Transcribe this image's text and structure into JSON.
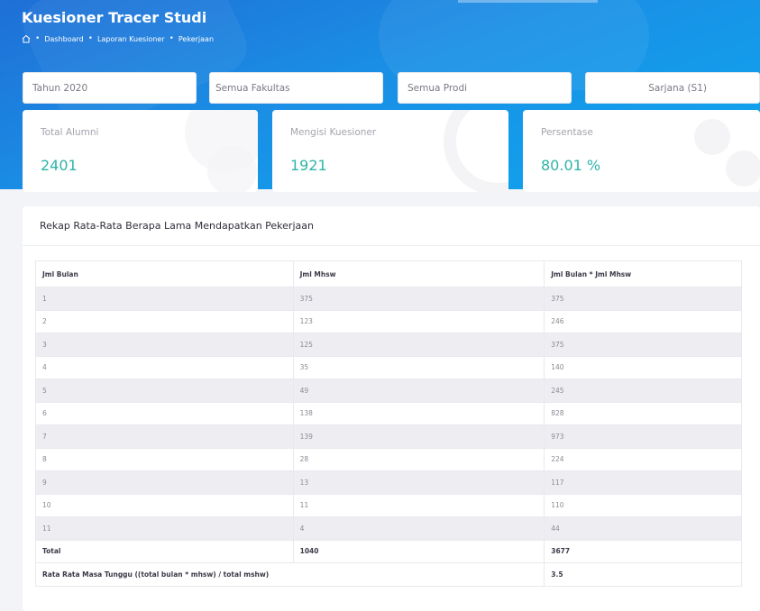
{
  "header": {
    "title": "Kuesioner Tracer Studi",
    "breadcrumb": [
      "Dashboard",
      "Laporan Kuesioner",
      "Pekerjaan"
    ]
  },
  "filters": {
    "year": "Tahun 2020",
    "faculty": "Semua Fakultas",
    "prodi": "Semua Prodi",
    "level": "Sarjana (S1)"
  },
  "stats": {
    "total_alumni": {
      "label": "Total Alumni",
      "value": "2401"
    },
    "mengisi": {
      "label": "Mengisi Kuesioner",
      "value": "1921"
    },
    "persentase": {
      "label": "Persentase",
      "value": "80.01 %"
    }
  },
  "panel": {
    "title": "Rekap Rata-Rata Berapa Lama Mendapatkan Pekerjaan"
  },
  "table": {
    "headers": [
      "Jml Bulan",
      "Jml Mhsw",
      "Jml Bulan * Jml Mhsw"
    ],
    "rows": [
      [
        "1",
        "375",
        "375"
      ],
      [
        "2",
        "123",
        "246"
      ],
      [
        "3",
        "125",
        "375"
      ],
      [
        "4",
        "35",
        "140"
      ],
      [
        "5",
        "49",
        "245"
      ],
      [
        "6",
        "138",
        "828"
      ],
      [
        "7",
        "139",
        "973"
      ],
      [
        "8",
        "28",
        "224"
      ],
      [
        "9",
        "13",
        "117"
      ],
      [
        "10",
        "11",
        "110"
      ],
      [
        "11",
        "4",
        "44"
      ]
    ],
    "total": [
      "Total",
      "1040",
      "3677"
    ],
    "average": {
      "label": "Rata Rata Masa Tunggu ((total bulan * mhsw) / total mshw)",
      "value": "3.5"
    }
  },
  "colors": {
    "header_gradient_start": "#1f6fd6",
    "header_gradient_end": "#0ea7ef",
    "stat_value": "#2fb4a8"
  }
}
